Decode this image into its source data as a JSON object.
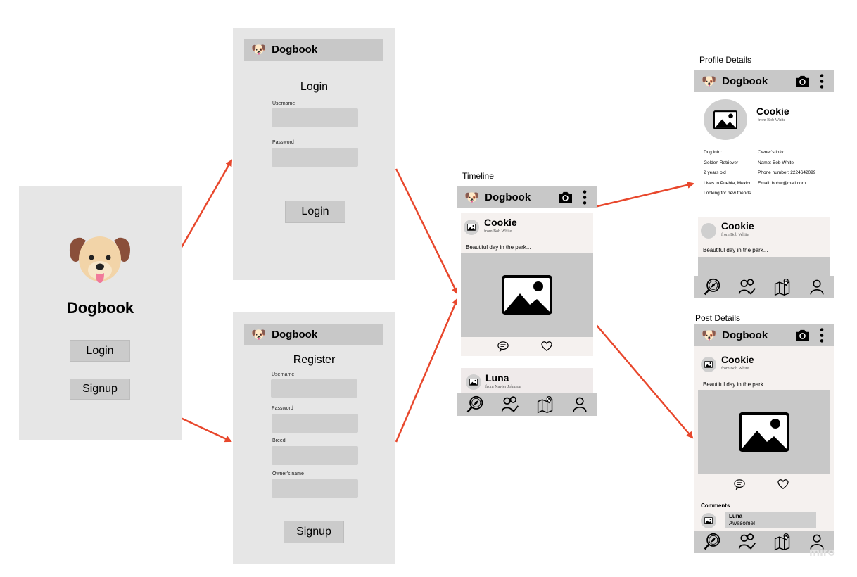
{
  "app_name": "Dogbook",
  "splash": {
    "title": "Dogbook",
    "login_label": "Login",
    "signup_label": "Signup"
  },
  "login_screen": {
    "heading": "Login",
    "username_label": "Username",
    "password_label": "Password",
    "button_label": "Login"
  },
  "register_screen": {
    "heading": "Register",
    "username_label": "Username",
    "password_label": "Password",
    "breed_label": "Breed",
    "owner_label": "Owner's name",
    "button_label": "Signup"
  },
  "timeline": {
    "section_title": "Timeline",
    "post1": {
      "name": "Cookie",
      "from": "from Bob White",
      "caption": "Beautiful day in the park..."
    },
    "post2": {
      "name": "Luna",
      "from": "from Xavier Johnson"
    }
  },
  "profile": {
    "section_title": "Profile Details",
    "name": "Cookie",
    "from": "from Bob White",
    "dog_info": [
      "Dog info:",
      "Golden Retriever",
      "2 years old",
      "Lives in Puebla, Mexico",
      "Looking for new friends"
    ],
    "owner_info": [
      "Owner's info:",
      "Name: Bob White",
      "Phone number: 2224642099",
      "Email: bobw@mail.com"
    ],
    "post": {
      "name": "Cookie",
      "from": "from Bob White",
      "caption": "Beautiful day in the park..."
    }
  },
  "post_details": {
    "section_title": "Post Details",
    "name": "Cookie",
    "from": "from Bob White",
    "caption": "Beautiful day in the park...",
    "comments_label": "Comments",
    "comment": {
      "name": "Luna",
      "text": "Awesome!"
    }
  },
  "watermark": "miro",
  "colors": {
    "arrow": "#e8472c",
    "panel": "#e6e6e6",
    "bar": "#c8c8c8"
  },
  "icons": [
    "dog-icon",
    "camera-icon",
    "more-vertical-icon",
    "image-icon",
    "comment-icon",
    "heart-icon",
    "explore-icon",
    "friends-icon",
    "map-icon",
    "profile-icon"
  ]
}
